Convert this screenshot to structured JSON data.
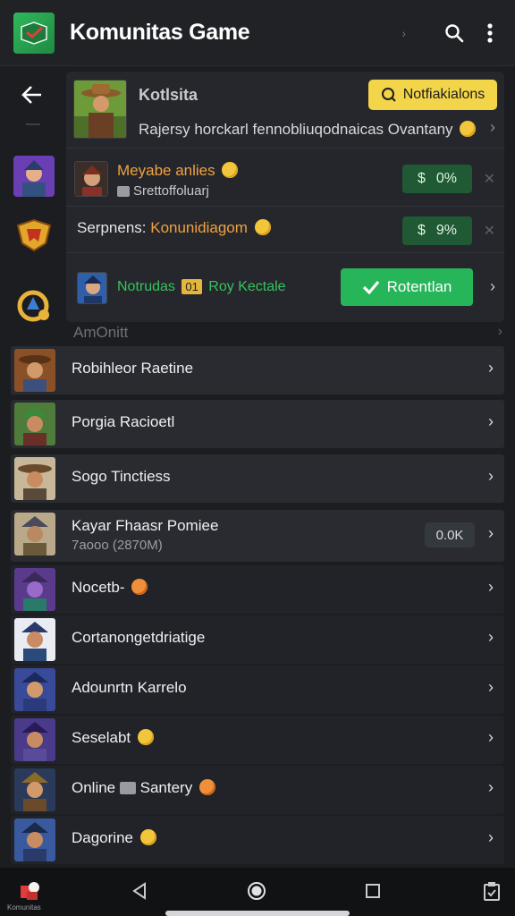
{
  "appbar": {
    "title": "Komunitas Game",
    "colors": {
      "logo": "#2fb85a",
      "background": "#212226"
    },
    "icons": [
      "search-icon",
      "more-vert-icon"
    ]
  },
  "rail": {
    "icons": [
      "back-arrow-icon",
      "avatar-knight-icon",
      "shield-emblem-icon",
      "ring-badge-icon"
    ]
  },
  "featured": {
    "name": "Kotlsita",
    "notify_label": "Notfiakialons",
    "description": "Rajersy horckarl fennobliuqodnaicas Ovantany",
    "accent": "#f3d54a"
  },
  "offers": [
    {
      "title": "Meyabe anlies",
      "subtitle": "Srettoffoluarj",
      "price_symbol": "$",
      "price": "0%"
    },
    {
      "title_prefix": "Serpnens:",
      "title_highlight": "Konunidiagom",
      "price_symbol": "$",
      "price": "9%"
    }
  ],
  "claim": {
    "text_before": "Notrudas",
    "badge": "01",
    "text_after": "Roy Kectale",
    "button_label": "Rotentlan",
    "button_color": "#27b55a"
  },
  "section": {
    "label": "AmOnitt"
  },
  "list": [
    {
      "title": "Robihleor Raetine"
    },
    {
      "title": "Porgia Racioetl"
    },
    {
      "title": "Sogo Tinctiess"
    },
    {
      "title": "Kayar Fhaasr Pomiee",
      "subtitle": "7aooo (2870M)",
      "pill": "0.0K"
    },
    {
      "title": "Nocetb-"
    },
    {
      "title": "Cortanongetdriatige"
    },
    {
      "title": "Adounrtn Karrelo"
    },
    {
      "title": "Seselabt"
    },
    {
      "title": "Online",
      "title_after": "Santery"
    },
    {
      "title": "Dagorine"
    }
  ],
  "navbar": {
    "home_label": "Komunitas",
    "icons": [
      "home-app-icon",
      "back-triangle-icon",
      "home-circle-icon",
      "recents-square-icon",
      "clipboard-icon"
    ]
  }
}
